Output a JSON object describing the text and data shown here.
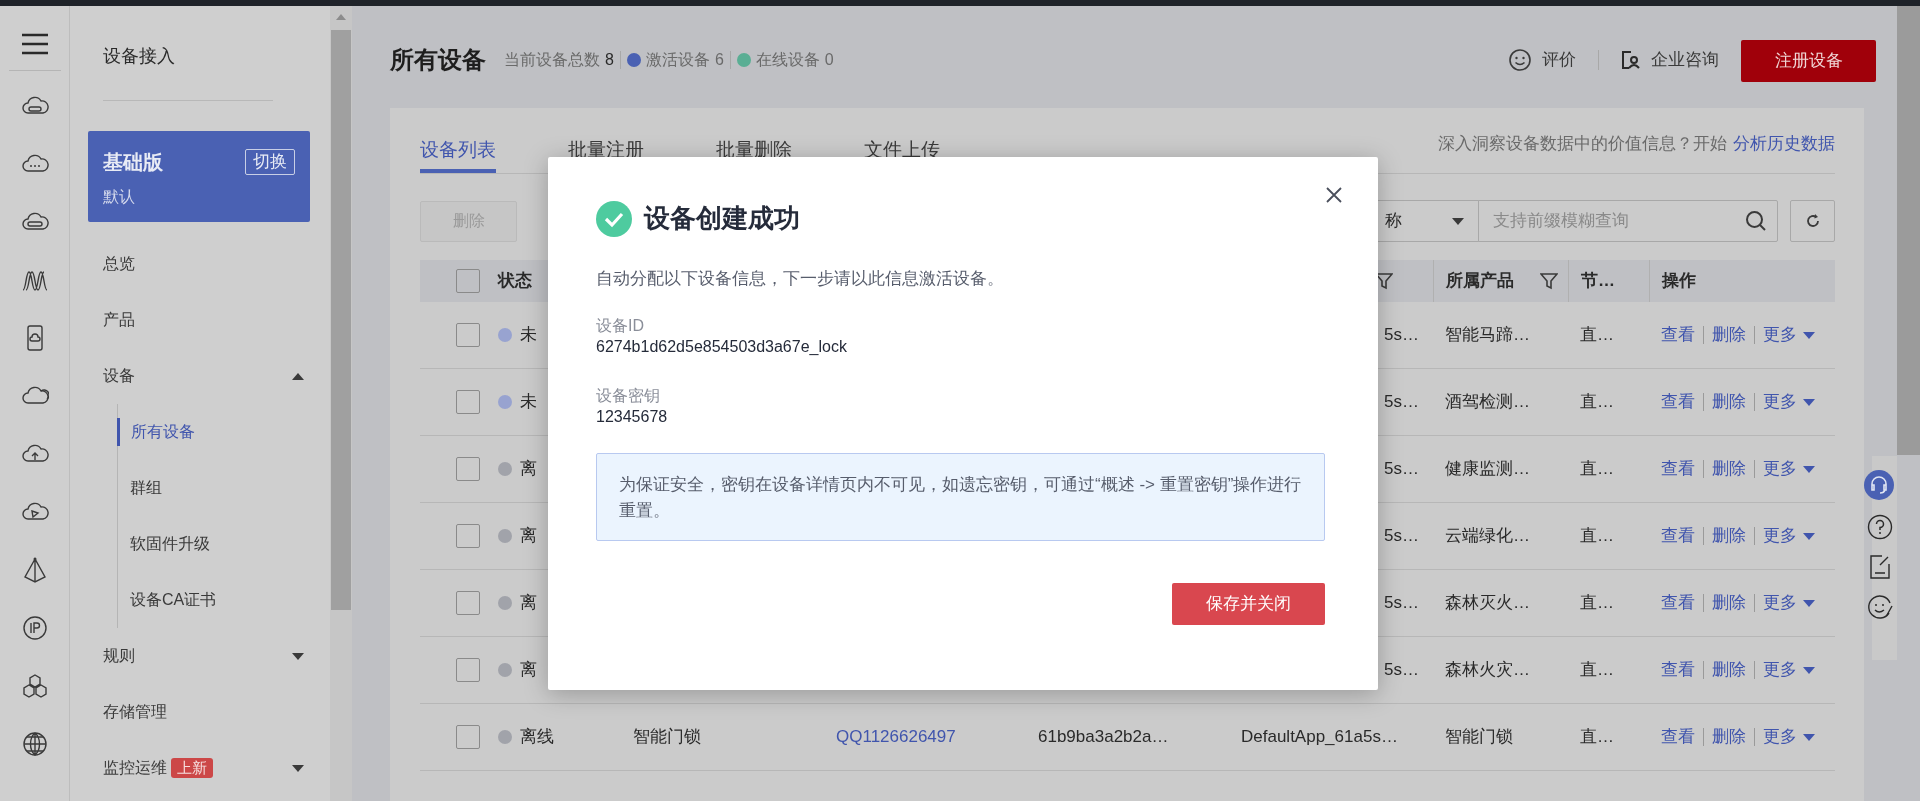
{
  "sidebar": {
    "title": "设备接入",
    "edition": {
      "name": "基础版",
      "switch_label": "切换",
      "instance": "默认"
    },
    "items": [
      {
        "label": "总览",
        "kind": "link",
        "selected": false
      },
      {
        "label": "产品",
        "kind": "link",
        "selected": false
      },
      {
        "label": "设备",
        "kind": "group",
        "selected": false,
        "expanded": true,
        "children": [
          {
            "label": "所有设备",
            "selected": true
          },
          {
            "label": "群组",
            "selected": false
          },
          {
            "label": "软固件升级",
            "selected": false
          },
          {
            "label": "设备CA证书",
            "selected": false
          }
        ]
      },
      {
        "label": "规则",
        "kind": "group",
        "selected": false,
        "expanded": false
      },
      {
        "label": "存储管理",
        "kind": "link",
        "selected": false
      },
      {
        "label": "监控运维",
        "kind": "group",
        "selected": false,
        "expanded": false,
        "badge": "上新"
      }
    ]
  },
  "header": {
    "title": "所有设备",
    "stats": [
      {
        "label": "当前设备总数",
        "value": "8"
      },
      {
        "label": "激活设备",
        "value": "6",
        "color": "#4a61b3"
      },
      {
        "label": "在线设备",
        "value": "0",
        "color": "#5aae94"
      }
    ],
    "actions": [
      {
        "label": "评价",
        "kind": "feedback"
      },
      {
        "label": "企业咨询",
        "kind": "consult"
      }
    ],
    "primary_button": "注册设备"
  },
  "tabs": [
    {
      "label": "设备列表",
      "selected": true
    },
    {
      "label": "批量注册",
      "selected": false
    },
    {
      "label": "批量删除",
      "selected": false
    },
    {
      "label": "文件上传",
      "selected": false
    }
  ],
  "promo": {
    "text": "深入洞察设备数据中的价值信息？开始",
    "link": "分析历史数据"
  },
  "toolbar": {
    "delete_button": {
      "label": "删除",
      "disabled": true
    },
    "filter_select": {
      "value": "称"
    },
    "search": {
      "placeholder": "支持前缀模糊查询"
    }
  },
  "table": {
    "header_checked": false,
    "columns": [
      {
        "label": "状态"
      },
      {
        "label": "所属产品"
      },
      {
        "label": "节…"
      },
      {
        "label": "操作"
      }
    ],
    "rows": [
      {
        "checked": false,
        "status": "未",
        "color": "#98a3d0",
        "app_tail": "5s…",
        "product": "智能马蹄…",
        "node": "直…",
        "actions": [
          "查看",
          "删除",
          "更多"
        ]
      },
      {
        "checked": false,
        "status": "未",
        "color": "#98a3d0",
        "app_tail": "5s…",
        "product": "酒驾检测…",
        "node": "直…",
        "actions": [
          "查看",
          "删除",
          "更多"
        ]
      },
      {
        "checked": false,
        "status": "离",
        "color": "#a1a3aa",
        "app_tail": "5s…",
        "product": "健康监测…",
        "node": "直…",
        "actions": [
          "查看",
          "删除",
          "更多"
        ]
      },
      {
        "checked": false,
        "status": "离",
        "color": "#a1a3aa",
        "app_tail": "5s…",
        "product": "云端绿化…",
        "node": "直…",
        "actions": [
          "查看",
          "删除",
          "更多"
        ]
      },
      {
        "checked": false,
        "status": "离",
        "color": "#a1a3aa",
        "app_tail": "5s…",
        "product": "森林灭火…",
        "node": "直…",
        "actions": [
          "查看",
          "删除",
          "更多"
        ]
      },
      {
        "checked": false,
        "status": "离",
        "color": "#a1a3aa",
        "app_tail": "5s…",
        "product": "森林火灾…",
        "node": "直…",
        "actions": [
          "查看",
          "删除",
          "更多"
        ]
      },
      {
        "checked": false,
        "status": "离线",
        "color": "#a1a3aa",
        "name": "智能门锁",
        "device_id": "QQ1126626497",
        "secret": "61b9ba3a2b2a…",
        "app": "DefaultApp_61a5s…",
        "product": "智能门锁",
        "node": "直…",
        "actions": [
          "查看",
          "删除",
          "更多"
        ]
      }
    ]
  },
  "modal": {
    "title": "设备创建成功",
    "description": "自动分配以下设备信息，下一步请以此信息激活设备。",
    "fields": [
      {
        "label": "设备ID",
        "value": "6274b1d62d5e854503d3a67e_lock"
      },
      {
        "label": "设备密钥",
        "value": "12345678"
      }
    ],
    "notice": "为保证安全，密钥在设备详情页内不可见，如遗忘密钥，可通过“概述 -> 重置密钥”操作进行重置。",
    "button": "保存并关闭"
  }
}
